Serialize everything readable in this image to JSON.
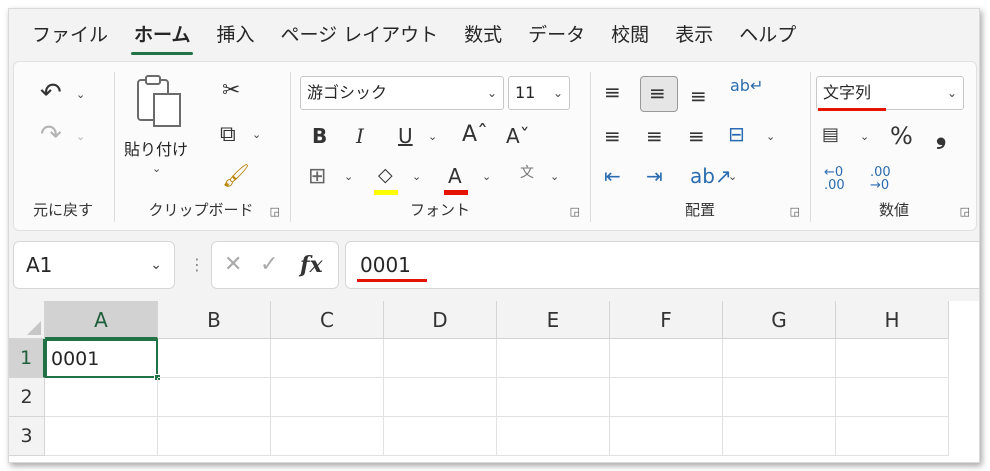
{
  "tabs": [
    "ファイル",
    "ホーム",
    "挿入",
    "ページ レイアウト",
    "数式",
    "データ",
    "校閲",
    "表示",
    "ヘルプ"
  ],
  "active_tab": "ホーム",
  "ribbon": {
    "undo_group_label": "元に戻す",
    "clipboard": {
      "paste_label": "貼り付け",
      "group_label": "クリップボード"
    },
    "font": {
      "name": "游ゴシック",
      "size": "11",
      "group_label": "フォント",
      "highlight_color": "#ffff00",
      "font_color": "#e51400"
    },
    "alignment": {
      "group_label": "配置"
    },
    "number": {
      "format": "文字列",
      "group_label": "数値"
    }
  },
  "formula_bar": {
    "name_box": "A1",
    "formula": "0001"
  },
  "grid": {
    "columns": [
      "A",
      "B",
      "C",
      "D",
      "E",
      "F",
      "G",
      "H"
    ],
    "rows": [
      "1",
      "2",
      "3"
    ],
    "cells": {
      "A1": "0001"
    },
    "selected_cell": "A1"
  },
  "colors": {
    "accent": "#217346",
    "annotation": "#e51400"
  }
}
